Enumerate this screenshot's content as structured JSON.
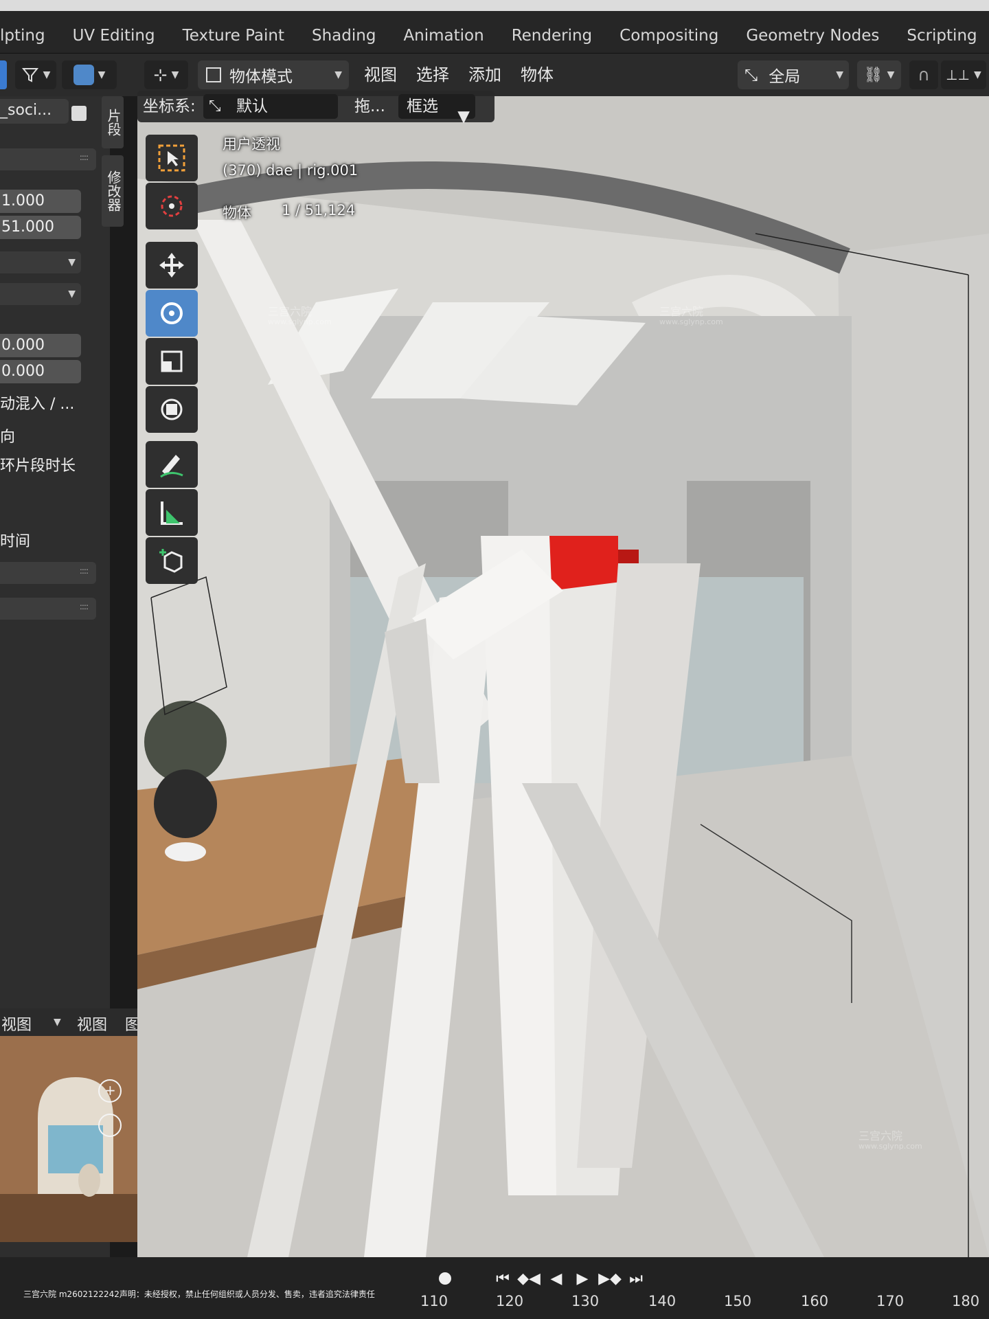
{
  "workspace_tabs": [
    "lpting",
    "UV Editing",
    "Texture Paint",
    "Shading",
    "Animation",
    "Rendering",
    "Compositing",
    "Geometry Nodes",
    "Scripting"
  ],
  "header": {
    "mode": "物体模式",
    "menus": [
      "视图",
      "选择",
      "添加",
      "物体"
    ],
    "transform_orientation": "全局"
  },
  "header2": {
    "coord_label": "坐标系:",
    "coord_value": "默认",
    "drag_label": "拖...",
    "select_mode": "框选"
  },
  "left_panel": {
    "object_name": "_soci...",
    "field_1": "1.000",
    "field_2": "51.000",
    "field_3": "0.000",
    "field_4": "0.000",
    "label_1": "动混入 / ...",
    "label_2": "向",
    "label_3": "环片段时长",
    "label_4": "时间",
    "vtab_1": "片段",
    "vtab_2": "修改器",
    "footer_left": "视图",
    "footer_mid": "视图",
    "footer_right": "图"
  },
  "viewport": {
    "view_name": "用户透视",
    "collection_line": "(370) dae | rig.001",
    "object_label": "物体",
    "object_count": "1 / 51,124"
  },
  "timeline": {
    "frame_numbers": [
      "110",
      "120",
      "130",
      "140",
      "150",
      "160",
      "170",
      "180"
    ]
  },
  "watermark": {
    "brand": "三宫六院",
    "url": "www.sglynp.com"
  },
  "copyright_notice": "三宫六院 m2602122242声明：未经授权，禁止任何组织或人员分发、售卖，违者追究法律责任"
}
